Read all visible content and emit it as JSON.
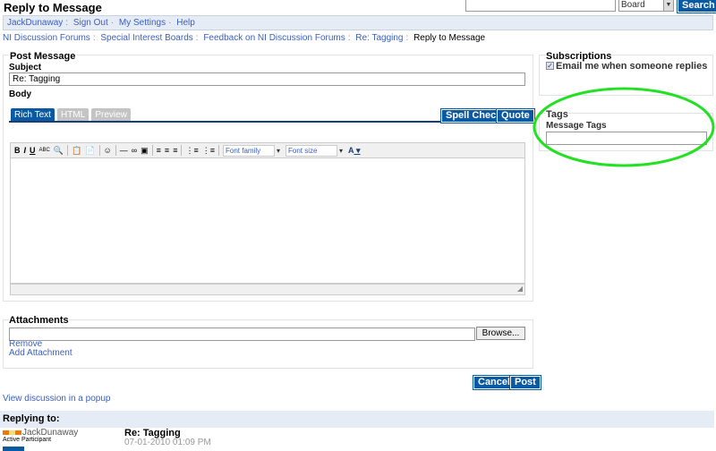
{
  "page_title": "Reply to Message",
  "search": {
    "value": "",
    "scope": "Board",
    "button": "Search"
  },
  "userbar": [
    "JackDunaway",
    "Sign Out",
    "My Settings",
    "Help"
  ],
  "breadcrumb": [
    "NI Discussion Forums",
    "Special Interest Boards",
    "Feedback on NI Discussion Forums",
    "Re: Tagging"
  ],
  "breadcrumb_current": "Reply to Message",
  "post": {
    "heading": "Post Message",
    "subject_label": "Subject",
    "subject_value": "Re: Tagging",
    "body_label": "Body",
    "tabs": [
      "Rich Text",
      "HTML",
      "Preview"
    ],
    "spell_check": "Spell Check",
    "quote": "Quote",
    "font_family": "Font family",
    "font_size": "Font size",
    "text_color_glyph": "A"
  },
  "subscriptions": {
    "heading": "Subscriptions",
    "email_label": "Email me when someone replies",
    "checked": true
  },
  "tags": {
    "heading": "Tags",
    "label": "Message Tags",
    "value": ""
  },
  "attachments": {
    "heading": "Attachments",
    "browse": "Browse...",
    "remove": "Remove",
    "add": "Add Attachment"
  },
  "actions": {
    "cancel": "Cancel",
    "post": "Post"
  },
  "popup_link": "View discussion in a popup",
  "replying": {
    "heading": "Replying to:",
    "author": "JackDunaway",
    "rank": "Active Participant",
    "subject": "Re: Tagging",
    "date": "07-01-2010 01:09 PM"
  },
  "colors": {
    "accent": "#0a5aa3",
    "highlight": "#22e022"
  }
}
